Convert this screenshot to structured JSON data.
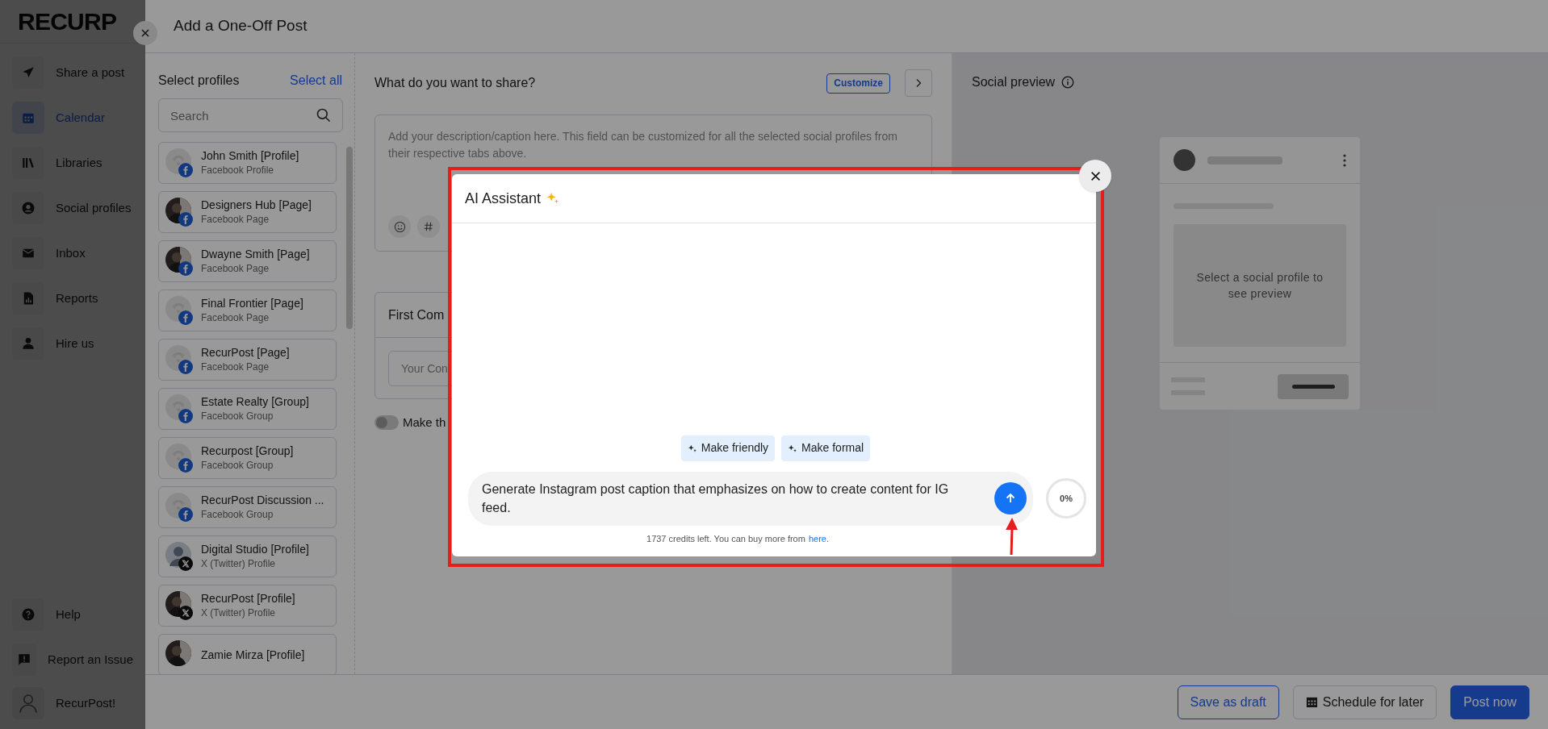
{
  "sidebar": {
    "logo": "RECURP",
    "items": [
      {
        "label": "Share a post",
        "selected": false
      },
      {
        "label": "Calendar",
        "selected": true
      },
      {
        "label": "Libraries",
        "selected": false
      },
      {
        "label": "Social profiles",
        "selected": false
      },
      {
        "label": "Inbox",
        "selected": false
      },
      {
        "label": "Reports",
        "selected": false
      },
      {
        "label": "Hire us",
        "selected": false
      }
    ],
    "bottom_items": [
      {
        "label": "Help"
      },
      {
        "label": "Report an Issue"
      }
    ],
    "account": "RecurPost!"
  },
  "drawer": {
    "title": "Add a One-Off Post"
  },
  "profiles": {
    "heading": "Select profiles",
    "select_all": "Select all",
    "search_placeholder": "Search",
    "items": [
      {
        "name": "John Smith [Profile]",
        "type": "Facebook Profile",
        "badge": {
          "kind": "facebook"
        },
        "avatar": {
          "kind": "placeholder"
        }
      },
      {
        "name": "Designers Hub [Page]",
        "type": "Facebook Page",
        "badge": {
          "kind": "facebook"
        }
      },
      {
        "name": "Dwayne Smith [Page]",
        "type": "Facebook Page",
        "badge": {
          "kind": "facebook"
        }
      },
      {
        "name": "Final Frontier [Page]",
        "type": "Facebook Page",
        "badge": {
          "kind": "facebook"
        },
        "avatar": {
          "kind": "placeholder"
        }
      },
      {
        "name": "RecurPost [Page]",
        "type": "Facebook Page",
        "badge": {
          "kind": "facebook"
        },
        "avatar": {
          "kind": "placeholder"
        }
      },
      {
        "name": "Estate Realty [Group]",
        "type": "Facebook Group",
        "badge": {
          "kind": "facebook"
        },
        "avatar": {
          "kind": "placeholder"
        }
      },
      {
        "name": "Recurpost [Group]",
        "type": "Facebook Group",
        "badge": {
          "kind": "facebook"
        },
        "avatar": {
          "kind": "placeholder"
        }
      },
      {
        "name": "RecurPost Discussion ...",
        "type": "Facebook Group",
        "badge": {
          "kind": "facebook"
        },
        "avatar": {
          "kind": "placeholder"
        }
      },
      {
        "name": "Digital Studio [Profile]",
        "type": "X (Twitter) Profile",
        "badge": {
          "kind": "x"
        },
        "avatar": {
          "kind": "silhouette"
        }
      },
      {
        "name": "RecurPost [Profile]",
        "type": "X (Twitter) Profile",
        "badge": {
          "kind": "x"
        }
      },
      {
        "name": "Zamie Mirza [Profile]"
      }
    ]
  },
  "composer": {
    "heading": "What do you want to share?",
    "customize": "Customize",
    "caption_placeholder": "Add your description/caption here. This field can be customized for all the selected social profiles from their respective tabs above.",
    "first_comment_title": "First Com",
    "comment_placeholder": "Your Con",
    "toggle": {
      "label": "Make th",
      "on": false
    }
  },
  "preview": {
    "title": "Social preview",
    "empty_text": "Select a social profile to see preview"
  },
  "actions": [
    {
      "label": "Save as draft",
      "kind": "outline"
    },
    {
      "label": "Schedule for later",
      "kind": "secondary"
    },
    {
      "label": "Post now",
      "kind": "primary"
    }
  ],
  "ai_assistant": {
    "title": "AI Assistant",
    "quick_actions": [
      "Make friendly",
      "Make formal"
    ],
    "prompt": "Generate Instagram post caption that emphasizes on how to create content for IG feed.",
    "usage": "0%",
    "credits_text": "1737 credits left. You can buy more from",
    "credits_link": "here."
  }
}
